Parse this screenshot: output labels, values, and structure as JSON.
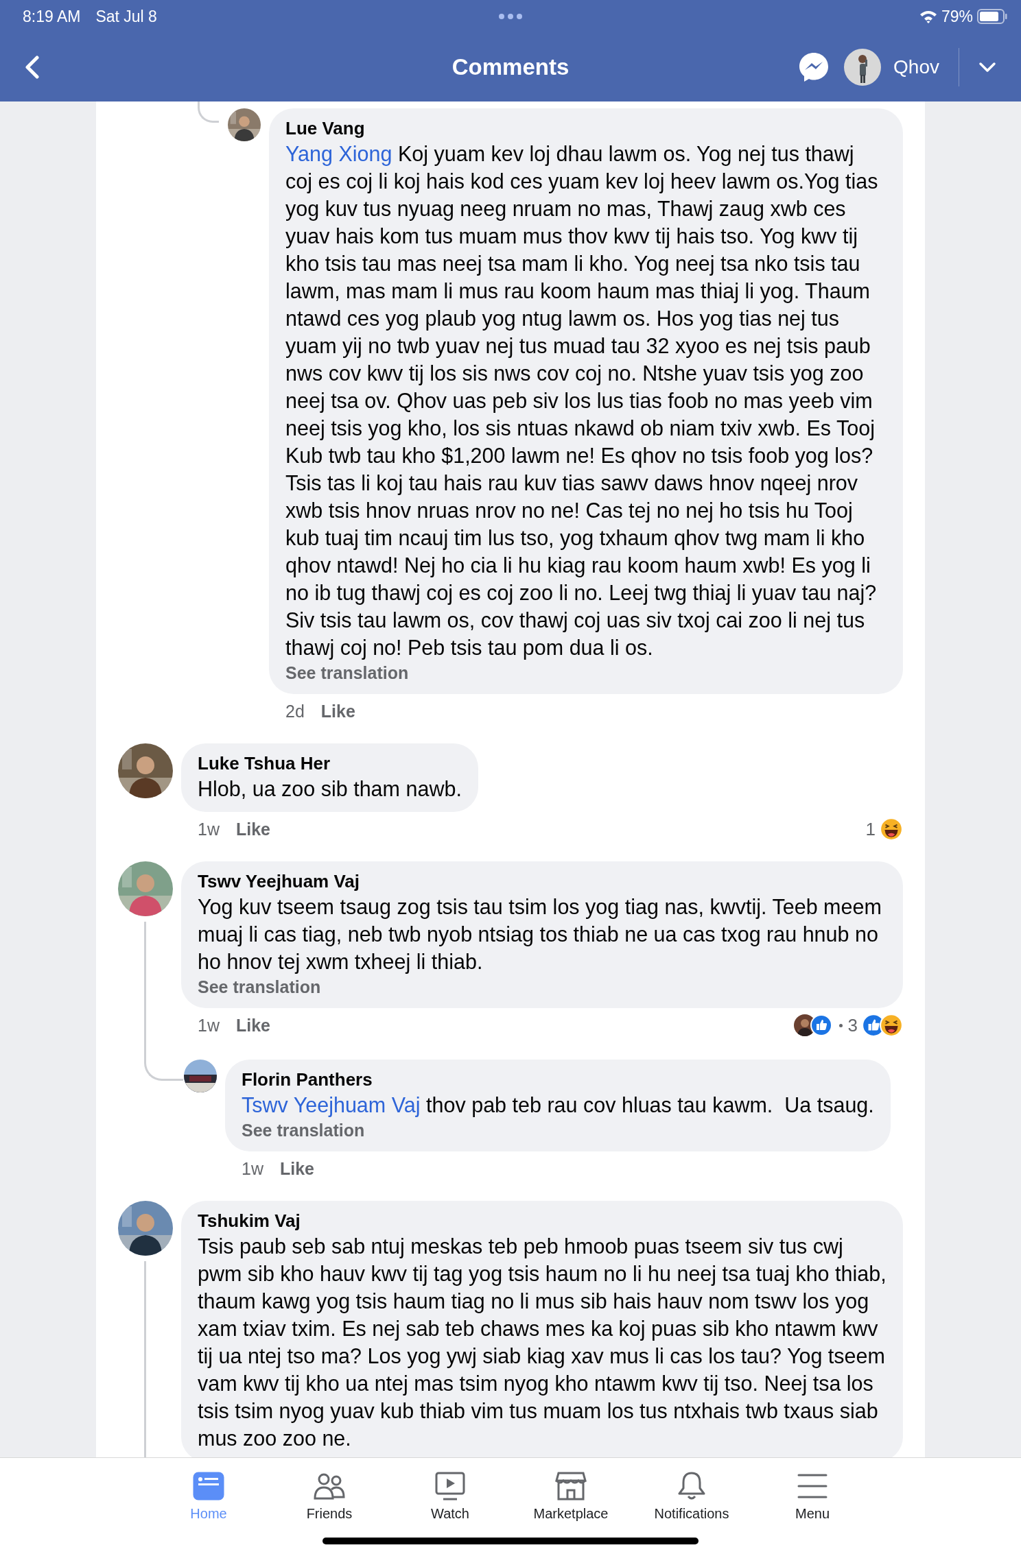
{
  "status_bar": {
    "time": "8:19 AM",
    "date": "Sat Jul 8",
    "battery": "79%"
  },
  "nav": {
    "title": "Comments",
    "profile_name": "Qhov"
  },
  "comments": [
    {
      "kind": "reply",
      "author": "Lue Vang",
      "mention": "Yang Xiong",
      "text": "Koj yuam kev loj dhau lawm os. Yog nej tus thawj coj es coj li koj hais kod ces yuam kev loj heev lawm os.Yog tias yog kuv tus nyuag neeg nruam no mas, Thawj zaug xwb ces yuav hais kom tus muam mus thov kwv tij hais tso. Yog kwv tij kho tsis tau mas neej tsa mam li kho. Yog neej tsa nko tsis tau lawm, mas mam li mus rau koom haum mas thiaj li yog. Thaum ntawd ces yog plaub yog ntug lawm os. Hos yog tias nej tus yuam yij no twb yuav nej tus muad tau 32 xyoo es nej tsis paub nws cov kwv tij los sis nws cov coj no. Ntshe yuav tsis yog zoo neej tsa ov. Qhov uas peb siv los lus tias foob no mas yeeb vim neej tsis yog kho, los sis ntuas nkawd ob niam txiv xwb. Es Tooj Kub twb tau kho $1,200 lawm ne! Es qhov no tsis foob yog los? Tsis tas li koj tau hais rau kuv tias sawv daws hnov nqeej nrov xwb tsis hnov nruas nrov no ne! Cas tej no nej ho tsis hu Tooj kub tuaj tim ncauj tim lus tso, yog txhaum qhov twg mam li kho qhov ntawd! Nej ho cia li hu kiag rau koom haum xwb! Es yog li no ib tug thawj coj es coj zoo li no. Leej twg thiaj li yuav tau naj? Siv tsis tau lawm os, cov thawj coj uas siv txoj cai zoo li nej tus thawj coj no! Peb tsis tau pom dua li os.",
      "see_translation": "See translation",
      "time": "2d",
      "like": "Like"
    },
    {
      "kind": "comment",
      "author": "Luke Tshua Her",
      "text": "Hlob, ua zoo sib tham nawb.",
      "time": "1w",
      "like": "Like",
      "reactions": {
        "friend": false,
        "count": "1",
        "icons": [
          {
            "kind": "haha"
          }
        ]
      }
    },
    {
      "kind": "comment",
      "author": "Tswv Yeejhuam Vaj",
      "text": "Yog kuv tseem tsaug zog tsis tau tsim los yog tiag nas, kwvtij. Teeb meem muaj li cas tiag, neb twb nyob ntsiag tos thiab ne ua cas txog rau hnub no ho hnov tej xwm txheej li thiab.",
      "see_translation": "See translation",
      "time": "1w",
      "like": "Like",
      "reactions": {
        "friend": true,
        "count": "3",
        "icons": [
          {
            "kind": "like"
          },
          {
            "kind": "haha"
          }
        ]
      },
      "children": [
        {
          "author": "Florin Panthers",
          "mention": "Tswv Yeejhuam Vaj",
          "text": "thov pab teb rau cov hluas tau kawm.  Ua tsaug.",
          "see_translation": "See translation",
          "time": "1w",
          "like": "Like"
        }
      ]
    },
    {
      "kind": "comment",
      "author": "Tshukim Vaj",
      "text": "Tsis paub seb sab ntuj meskas teb peb hmoob puas tseem siv tus cwj pwm sib kho hauv kwv tij tag yog tsis haum no li hu neej tsa tuaj kho thiab, thaum kawg yog tsis haum tiag no li mus sib hais hauv nom tswv los yog xam txiav txim. Es nej sab teb chaws mes ka koj puas sib kho ntawm kwv tij ua ntej tso ma? Los yog ywj siab kiag xav mus li cas los tau? Yog tseem vam kwv tij kho ua ntej mas tsim nyog kho ntawm kwv tij tso. Neej tsa los tsis tsim nyog yuav kub thiab vim tus muam los tus ntxhais twb txaus siab mus zoo zoo ne.",
      "has_replies": true
    }
  ],
  "tabs": [
    {
      "kind": "home",
      "label": "Home",
      "selected": true
    },
    {
      "kind": "friends",
      "label": "Friends",
      "selected": false
    },
    {
      "kind": "watch",
      "label": "Watch",
      "selected": false
    },
    {
      "kind": "marketplace",
      "label": "Marketplace",
      "selected": false
    },
    {
      "kind": "notifications",
      "label": "Notifications",
      "selected": false
    },
    {
      "kind": "menu",
      "label": "Menu",
      "selected": false
    }
  ]
}
